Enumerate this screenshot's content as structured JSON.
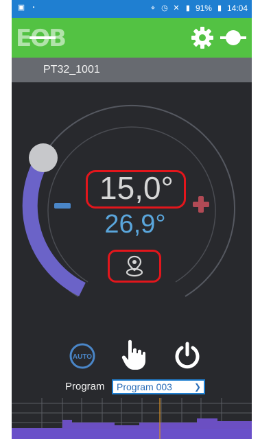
{
  "status_bar": {
    "notification_icon": "image-icon",
    "battery_percent": "91%",
    "time": "14:04"
  },
  "app_bar": {
    "logo_text": "EOB",
    "settings_icon": "gear-icon",
    "connection_icon": "plug-icon"
  },
  "device": {
    "name": "PT32_1001"
  },
  "thermostat": {
    "setpoint": "15,0°",
    "current_temp": "26,9°",
    "location_icon": "location-pin-icon",
    "colors": {
      "arc_fill": "#6b63c8",
      "setpoint_highlight": "#e3161c",
      "current_temp": "#5aa6dc"
    }
  },
  "controls": {
    "auto_label": "AUTO",
    "manual_icon": "hand-icon",
    "power_icon": "power-icon"
  },
  "program": {
    "label": "Program",
    "selected": "Program 003"
  }
}
